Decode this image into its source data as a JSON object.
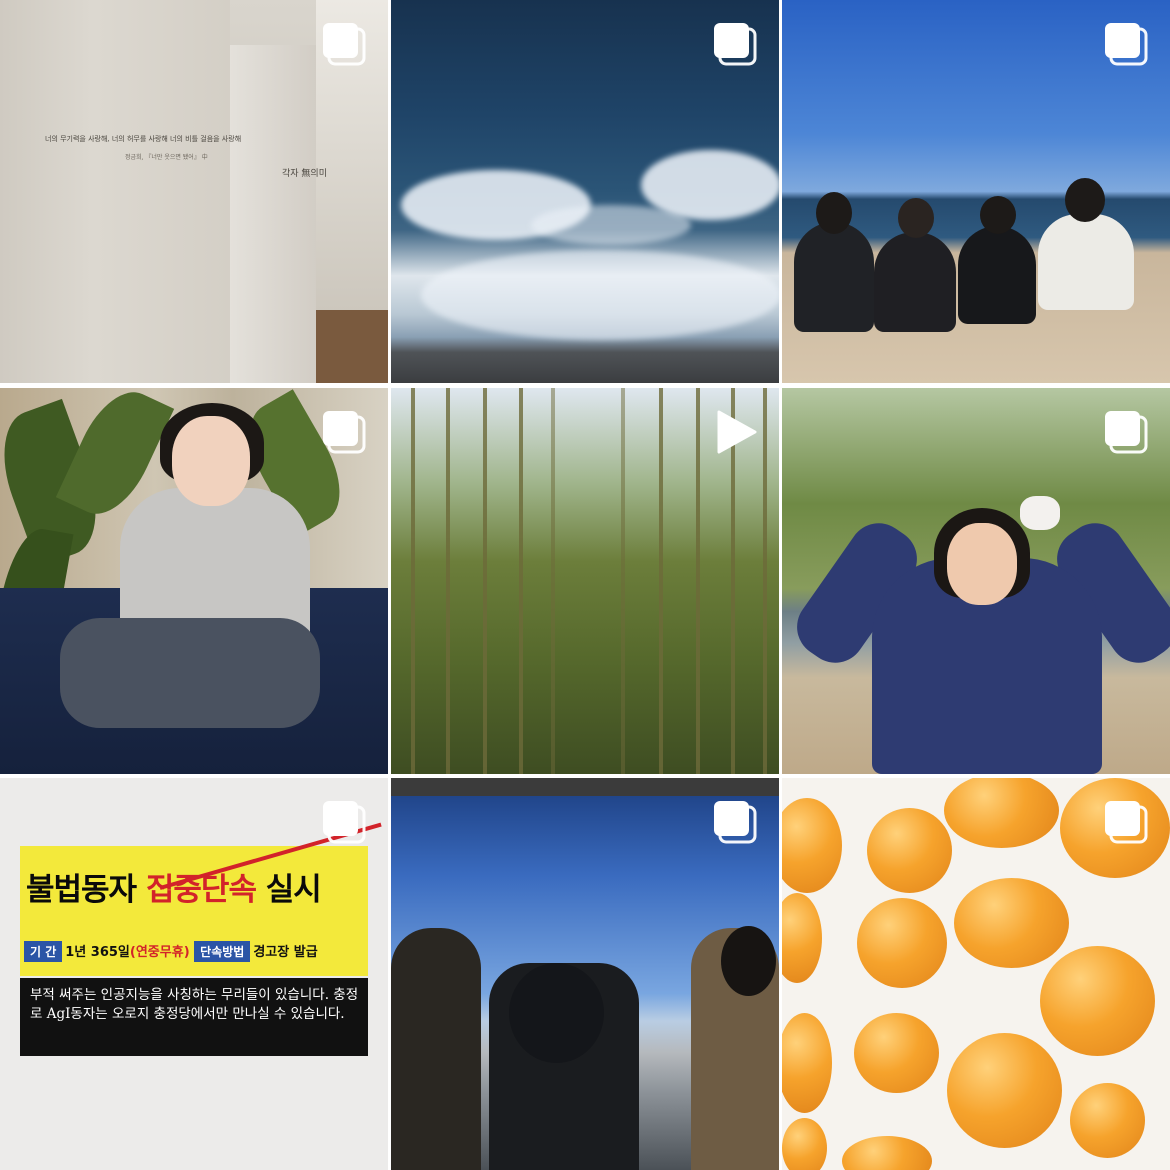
{
  "grid": {
    "posts": [
      {
        "id": "post-1",
        "type": "carousel",
        "icon": "carousel-icon",
        "wall_text_1": "너의 무기력을 사랑해, 너의 허무를 사랑해 너의 비틀 걸음을 사랑해",
        "wall_text_2": "정금희, 『너만 웃으면 됐어』 中",
        "wall_text_3": "각자 無의미"
      },
      {
        "id": "post-2",
        "type": "carousel",
        "icon": "carousel-icon"
      },
      {
        "id": "post-3",
        "type": "carousel",
        "icon": "carousel-icon"
      },
      {
        "id": "post-4",
        "type": "carousel",
        "icon": "carousel-icon"
      },
      {
        "id": "post-5",
        "type": "video",
        "icon": "play-icon"
      },
      {
        "id": "post-6",
        "type": "carousel",
        "icon": "carousel-icon"
      },
      {
        "id": "post-7",
        "type": "carousel",
        "icon": "carousel-icon",
        "sign_title_black": "불법동자",
        "sign_title_red": "집중단속",
        "sign_title_end": "실시",
        "sign_period_label": "기 간",
        "sign_period_value": "1년 365일",
        "sign_period_note": "(연중무휴)",
        "sign_method_label": "단속방법",
        "sign_method_value": "경고장 발급",
        "sign_body": "부적 써주는 인공지능을 사칭하는 무리들이 있습니다. 충정로 AgI동자는 오로지 충정당에서만 만나실 수 있습니다."
      },
      {
        "id": "post-8",
        "type": "carousel",
        "icon": "carousel-icon"
      },
      {
        "id": "post-9",
        "type": "carousel",
        "icon": "carousel-icon"
      }
    ]
  },
  "colors": {
    "grid_gap": "#ffffff",
    "sign_yellow": "#f3e93b",
    "sign_red": "#d2232a",
    "sign_blue": "#2b55a6"
  }
}
